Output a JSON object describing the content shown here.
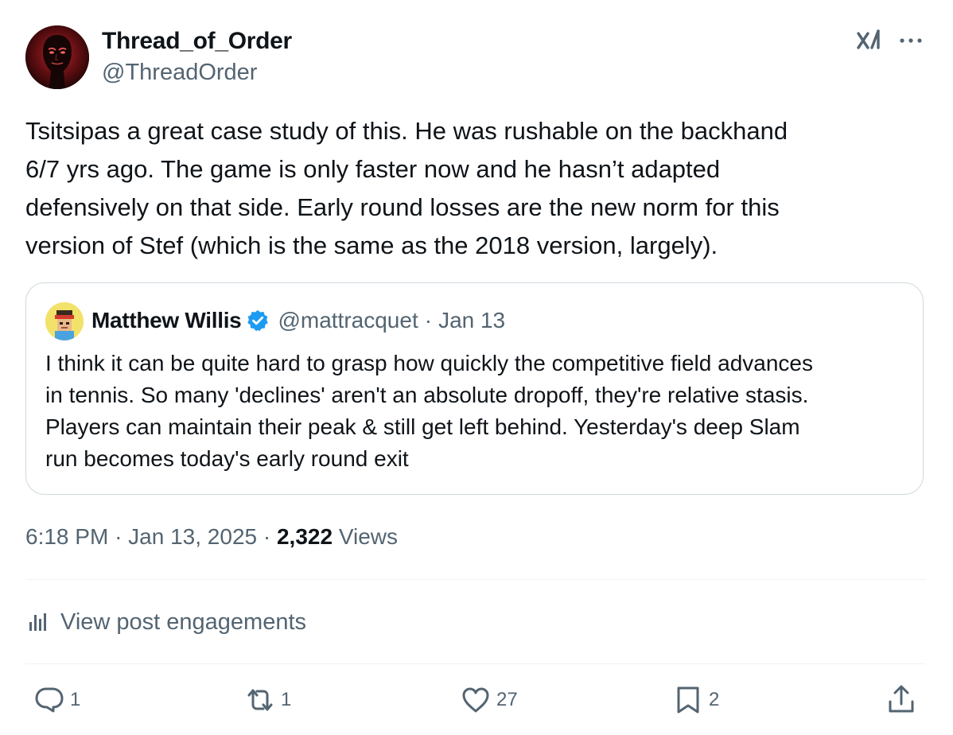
{
  "author": {
    "display_name": "Thread_of_Order",
    "handle": "@ThreadOrder"
  },
  "header_icons": [
    "grok-icon",
    "more-icon"
  ],
  "post": {
    "text": "Tsitsipas a great case study of this. He was rushable on the backhand\n6/7 yrs ago. The game is only faster now and he hasn’t adapted\ndefensively on that side. Early round losses are the new norm for this\nversion of Stef (which is the same as the 2018 version, largely)."
  },
  "quote": {
    "display_name": "Matthew Willis",
    "handle": "@mattracquet",
    "separator": "·",
    "date": "Jan 13",
    "text": "I think it can be quite hard to grasp how quickly the competitive field advances\nin tennis. So many 'declines' aren't an absolute dropoff, they're relative stasis.\nPlayers can maintain their peak & still get left behind. Yesterday's deep Slam\nrun becomes today's early round exit"
  },
  "meta": {
    "time": "6:18 PM",
    "sep1": "·",
    "date": "Jan 13, 2025",
    "sep2": "·",
    "views_count": "2,322",
    "views_label": "Views"
  },
  "engagements": {
    "label": "View post engagements"
  },
  "actions": {
    "replies": "1",
    "reposts": "1",
    "likes": "27",
    "bookmarks": "2"
  },
  "colors": {
    "text_primary": "#0f1419",
    "text_secondary": "#536471",
    "border": "#cfd9de",
    "divider": "#eff3f4",
    "verified": "#1d9bf0"
  }
}
